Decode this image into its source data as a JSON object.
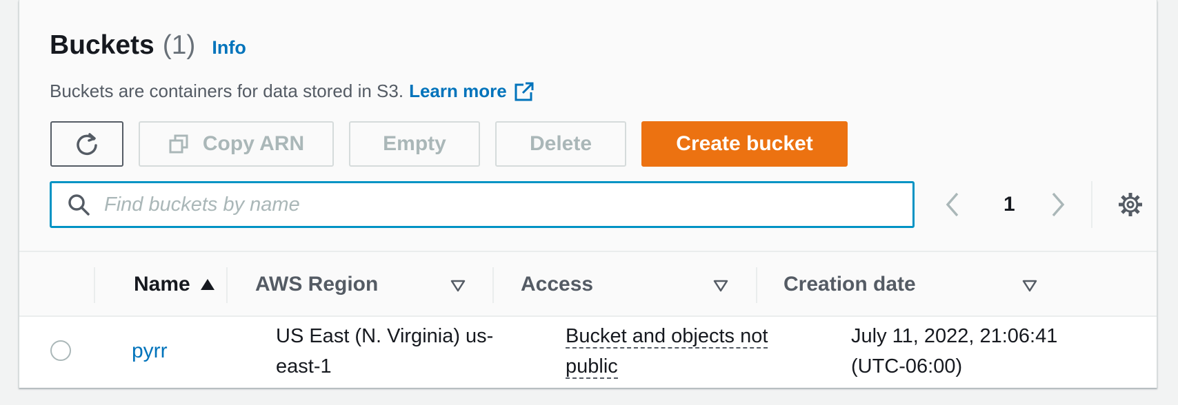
{
  "header": {
    "title": "Buckets",
    "count": "(1)",
    "info_link": "Info",
    "description": "Buckets are containers for data stored in S3.",
    "learn_more": "Learn more"
  },
  "toolbar": {
    "refresh_icon": "refresh-icon",
    "copy_arn": "Copy ARN",
    "empty": "Empty",
    "delete": "Delete",
    "create": "Create bucket"
  },
  "search": {
    "placeholder": "Find buckets by name",
    "value": ""
  },
  "pagination": {
    "current_page": "1"
  },
  "table": {
    "columns": [
      {
        "label": "Name",
        "sort": "ascending"
      },
      {
        "label": "AWS Region"
      },
      {
        "label": "Access"
      },
      {
        "label": "Creation date"
      }
    ],
    "rows": [
      {
        "name": "pyrr",
        "region": "US East (N. Virginia) us-east-1",
        "access": "Bucket and objects not public",
        "created": "July 11, 2022, 21:06:41 (UTC-06:00)"
      }
    ]
  },
  "colors": {
    "accent": "#0073bb",
    "primary_button": "#ec7211",
    "focus_border": "#0093c4",
    "disabled_text": "#aab7b8"
  }
}
